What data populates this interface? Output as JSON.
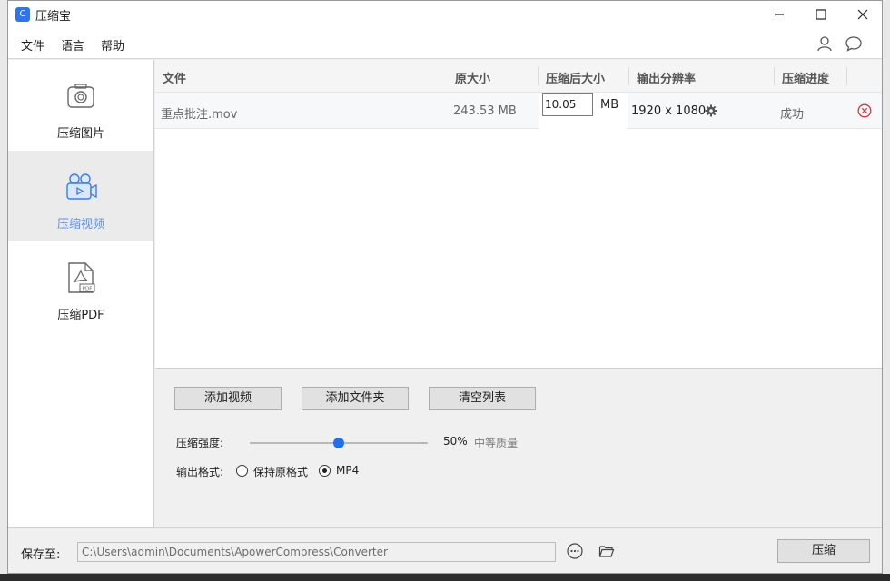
{
  "window": {
    "title": "压缩宝"
  },
  "menu": {
    "items": [
      "文件",
      "语言",
      "帮助"
    ]
  },
  "sidebar": {
    "items": [
      {
        "label": "压缩图片",
        "active": false
      },
      {
        "label": "压缩视频",
        "active": true
      },
      {
        "label": "压缩PDF",
        "active": false
      }
    ]
  },
  "table": {
    "headers": [
      "文件",
      "原大小",
      "压缩后大小",
      "输出分辨率",
      "压缩进度"
    ],
    "rows": [
      {
        "file": "重点批注.mov",
        "original_size": "243.53 MB",
        "compressed_size": "10.05",
        "unit": "MB",
        "resolution": "1920 x 1080",
        "status": "成功"
      }
    ]
  },
  "actions": {
    "add_video": "添加视频",
    "add_folder": "添加文件夹",
    "clear_list": "清空列表"
  },
  "settings": {
    "strength_label": "压缩强度:",
    "strength_percent": "50%",
    "strength_value": 0.5,
    "quality_label": "中等质量",
    "format_label": "输出格式:",
    "format_options": [
      "保持原格式",
      "MP4"
    ],
    "format_selected": "MP4"
  },
  "footer": {
    "save_label": "保存至:",
    "save_path": "C:\\Users\\admin\\Documents\\ApowerCompress\\Converter",
    "compress_label": "压缩"
  },
  "colors": {
    "accent": "#1f6ff2",
    "active_label": "#5b8ff0",
    "remove_icon": "#e0303a"
  }
}
